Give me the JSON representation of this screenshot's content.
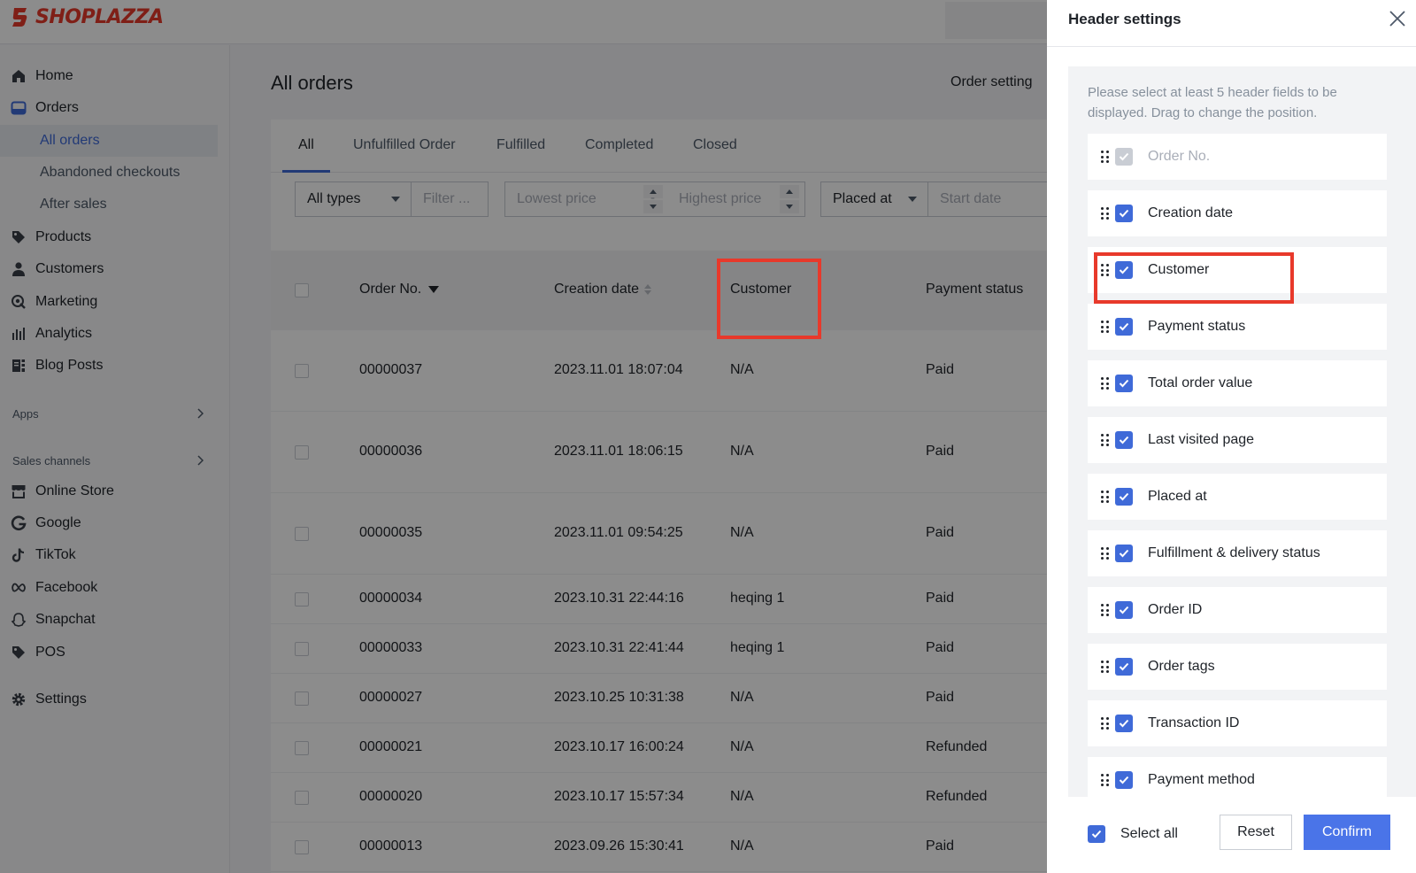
{
  "brand": {
    "name": "SHOPLAZZA",
    "color": "#e8392b"
  },
  "accent": "#3f6ad8",
  "sidebar": {
    "items": [
      {
        "label": "Home",
        "icon": "home-icon"
      },
      {
        "label": "Orders",
        "icon": "orders-icon"
      },
      {
        "label": "All orders",
        "active": true
      },
      {
        "label": "Abandoned checkouts"
      },
      {
        "label": "After sales"
      },
      {
        "label": "Products",
        "icon": "tag-icon"
      },
      {
        "label": "Customers",
        "icon": "person-icon"
      },
      {
        "label": "Marketing",
        "icon": "megaphone-icon"
      },
      {
        "label": "Analytics",
        "icon": "bar-chart-icon"
      },
      {
        "label": "Blog Posts",
        "icon": "blog-icon"
      }
    ],
    "apps_label": "Apps",
    "sales_channels_label": "Sales channels",
    "channels": [
      {
        "label": "Online Store",
        "icon": "store-icon"
      },
      {
        "label": "Google",
        "icon": "google-icon"
      },
      {
        "label": "TikTok",
        "icon": "tiktok-icon"
      },
      {
        "label": "Facebook",
        "icon": "meta-icon"
      },
      {
        "label": "Snapchat",
        "icon": "ghost-icon"
      },
      {
        "label": "POS",
        "icon": "pos-tag-icon"
      }
    ],
    "settings_label": "Settings"
  },
  "main": {
    "title": "All orders",
    "order_setting": "Order setting",
    "tabs": [
      "All",
      "Unfulfilled Order",
      "Fulfilled",
      "Completed",
      "Closed"
    ],
    "filters": {
      "type_value": "All types",
      "filter_placeholder": "Filter ...",
      "lowest_price_placeholder": "Lowest price",
      "price_sep": "-",
      "highest_price_placeholder": "Highest price",
      "date_field_value": "Placed at",
      "start_date_placeholder": "Start date"
    },
    "columns": [
      "Order No.",
      "Creation date",
      "Customer",
      "Payment status"
    ],
    "rows": [
      {
        "order_no": "00000037",
        "created": "2023.11.01 18:07:04",
        "customer": "N/A",
        "payment": "Paid"
      },
      {
        "order_no": "00000036",
        "created": "2023.11.01 18:06:15",
        "customer": "N/A",
        "payment": "Paid"
      },
      {
        "order_no": "00000035",
        "created": "2023.11.01 09:54:25",
        "customer": "N/A",
        "payment": "Paid"
      },
      {
        "order_no": "00000034",
        "created": "2023.10.31 22:44:16",
        "customer": "heqing 1",
        "payment": "Paid"
      },
      {
        "order_no": "00000033",
        "created": "2023.10.31 22:41:44",
        "customer": "heqing 1",
        "payment": "Paid"
      },
      {
        "order_no": "00000027",
        "created": "2023.10.25 10:31:38",
        "customer": "N/A",
        "payment": "Paid"
      },
      {
        "order_no": "00000021",
        "created": "2023.10.17 16:00:24",
        "customer": "N/A",
        "payment": "Refunded"
      },
      {
        "order_no": "00000020",
        "created": "2023.10.17 15:57:34",
        "customer": "N/A",
        "payment": "Refunded"
      },
      {
        "order_no": "00000013",
        "created": "2023.09.26 15:30:41",
        "customer": "N/A",
        "payment": "Paid"
      }
    ]
  },
  "drawer": {
    "title": "Header settings",
    "hint": "Please select at least 5 header fields to be displayed. Drag to change the position.",
    "fields": [
      {
        "label": "Order No.",
        "checked": true,
        "disabled": true
      },
      {
        "label": "Creation date",
        "checked": true
      },
      {
        "label": "Customer",
        "checked": true
      },
      {
        "label": "Payment status",
        "checked": true
      },
      {
        "label": "Total order value",
        "checked": true
      },
      {
        "label": "Last visited page",
        "checked": true
      },
      {
        "label": "Placed at",
        "checked": true
      },
      {
        "label": "Fulfillment & delivery status",
        "checked": true
      },
      {
        "label": "Order ID",
        "checked": true
      },
      {
        "label": "Order tags",
        "checked": true
      },
      {
        "label": "Transaction ID",
        "checked": true
      },
      {
        "label": "Payment method",
        "checked": true
      }
    ],
    "select_all_label": "Select all",
    "reset_label": "Reset",
    "confirm_label": "Confirm"
  },
  "highlight_color": "#e8392b"
}
